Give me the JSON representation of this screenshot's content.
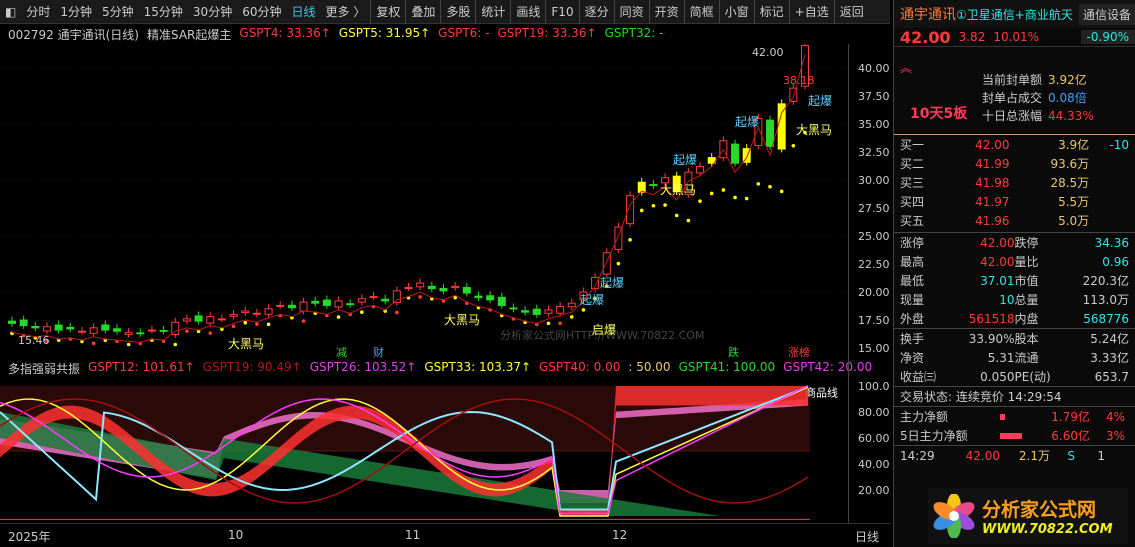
{
  "toolbar": {
    "periods": [
      "分时",
      "1分钟",
      "5分钟",
      "15分钟",
      "30分钟",
      "60分钟",
      "日线",
      "更多 〉"
    ],
    "active": "日线",
    "buttons": [
      "复权",
      "叠加",
      "多股",
      "统计",
      "画线",
      "F10",
      "逐分",
      "同资",
      "开资",
      "简框",
      "小窗",
      "标记",
      "+自选",
      "返回"
    ]
  },
  "main_info": {
    "code_name": "002792 通宇通讯(日线)",
    "indicator": "精准SAR起爆主",
    "items": [
      {
        "t": "GSPT4: 33.36↑",
        "c": "#ff3b3b"
      },
      {
        "t": "GSPT5: 31.95↑",
        "c": "#ffff3b"
      },
      {
        "t": "GSPT6: -",
        "c": "#ff3b3b"
      },
      {
        "t": "GSPT19: 33.36↑",
        "c": "#ff3b3b"
      },
      {
        "t": "GSPT32: -",
        "c": "#29d829"
      }
    ]
  },
  "price_axis": [
    "40.00",
    "37.50",
    "35.00",
    "32.50",
    "30.00",
    "27.50",
    "25.00",
    "22.50",
    "20.00",
    "17.50",
    "15.00"
  ],
  "annotations": {
    "high": "42.00",
    "low": "15.46",
    "marker": "38.18",
    "labels": [
      "大黑马",
      "大黑马",
      "大黑马",
      "大黑马",
      "起爆",
      "起爆",
      "起爆",
      "起爆",
      "起爆",
      "启爆"
    ],
    "badges": [
      "减",
      "财",
      "跌",
      "涨榜"
    ],
    "watermark": "分析家公式网HTTP://WWW.70822.COM"
  },
  "chart_data": {
    "type": "candlestick",
    "closes": [
      17.2,
      17.0,
      16.8,
      16.9,
      16.6,
      16.7,
      16.5,
      16.8,
      16.6,
      16.5,
      16.4,
      16.3,
      16.6,
      16.5,
      17.3,
      17.6,
      17.4,
      17.8,
      17.6,
      18.0,
      18.3,
      18.1,
      18.5,
      18.8,
      18.6,
      19.1,
      19.0,
      18.8,
      19.2,
      18.9,
      19.4,
      19.6,
      19.2,
      20.1,
      20.4,
      20.8,
      20.3,
      20.1,
      20.5,
      19.9,
      19.5,
      19.3,
      18.8,
      18.5,
      18.2,
      18.0,
      18.4,
      18.7,
      19.0,
      20.0,
      21.3,
      23.5,
      25.8,
      28.6,
      29.8,
      29.5,
      30.2,
      29.0,
      30.7,
      31.2,
      32.0,
      33.5,
      31.5,
      32.8,
      35.5,
      33.0,
      36.8,
      38.2,
      42.0
    ],
    "ylim": [
      15,
      40
    ]
  },
  "ind_info": {
    "name": "多指强弱共振",
    "items": [
      {
        "t": "GSPT12: 101.61↑",
        "c": "#ff3b3b"
      },
      {
        "t": "GSPT19: 90.49↑",
        "c": "#b01818"
      },
      {
        "t": "GSPT26: 103.52↑",
        "c": "#e040e0"
      },
      {
        "t": "GSPT33: 103.37↑",
        "c": "#ffff3b"
      },
      {
        "t": "GSPT40: 0.00",
        "c": "#ff3b3b"
      },
      {
        "t": ": 50.00",
        "c": "#e8c96a"
      },
      {
        "t": "GSPT41: 100.00",
        "c": "#29d829"
      },
      {
        "t": "GSPT42: 20.00",
        "c": "#e040e0"
      }
    ],
    "axis": [
      "100.0",
      "80.00",
      "60.00",
      "40.00",
      "20.00"
    ],
    "label": "商品线"
  },
  "date_axis": [
    "2025年",
    "10",
    "11",
    "12"
  ],
  "period_label": "日线",
  "quote": {
    "name": "通宇通讯",
    "concept": "①卫星通信+商业航天",
    "sector": "通信设备",
    "price": "42.00",
    "change": "3.82",
    "pct": "10.01%",
    "sector_pct": "-0.90%",
    "boards": "10天5板",
    "seal": [
      {
        "k": "当前封单额",
        "v": "3.92亿"
      },
      {
        "k": "封单占成交",
        "v": "0.08倍"
      },
      {
        "k": "十日总涨幅",
        "v": "44.33%"
      }
    ],
    "bids": [
      {
        "k": "买一",
        "p": "42.00",
        "v": "3.9亿",
        "d": "-10"
      },
      {
        "k": "买二",
        "p": "41.99",
        "v": "93.6万",
        "d": ""
      },
      {
        "k": "买三",
        "p": "41.98",
        "v": "28.5万",
        "d": ""
      },
      {
        "k": "买四",
        "p": "41.97",
        "v": "5.5万",
        "d": ""
      },
      {
        "k": "买五",
        "p": "41.96",
        "v": "5.0万",
        "d": ""
      }
    ],
    "stats": [
      [
        "涨停",
        "42.00",
        "跌停",
        "34.36"
      ],
      [
        "最高",
        "42.00",
        "量比",
        "0.96"
      ],
      [
        "最低",
        "37.01",
        "市值",
        "220.3亿"
      ],
      [
        "现量",
        "10",
        "总量",
        "113.0万"
      ],
      [
        "外盘",
        "561518",
        "内盘",
        "568776"
      ]
    ],
    "stats2": [
      [
        "换手",
        "33.90%",
        "股本",
        "5.24亿"
      ],
      [
        "净资",
        "5.31",
        "流通",
        "3.33亿"
      ],
      [
        "收益㈢",
        "0.050",
        "PE(动)",
        "653.7"
      ]
    ],
    "status": "交易状态: 连续竞价 14:29:54",
    "flow": [
      {
        "k": "主力净额",
        "v": "1.79亿",
        "p": "4%"
      },
      {
        "k": "5日主力净额",
        "v": "6.60亿",
        "p": "3%"
      }
    ],
    "ticks": [
      {
        "t": "14:29",
        "p": "42.00",
        "v": "2.1万",
        "s": "S",
        "n": "1"
      }
    ],
    "logo": {
      "title": "分析家公式网",
      "url": "WWW.70822.COM"
    }
  }
}
